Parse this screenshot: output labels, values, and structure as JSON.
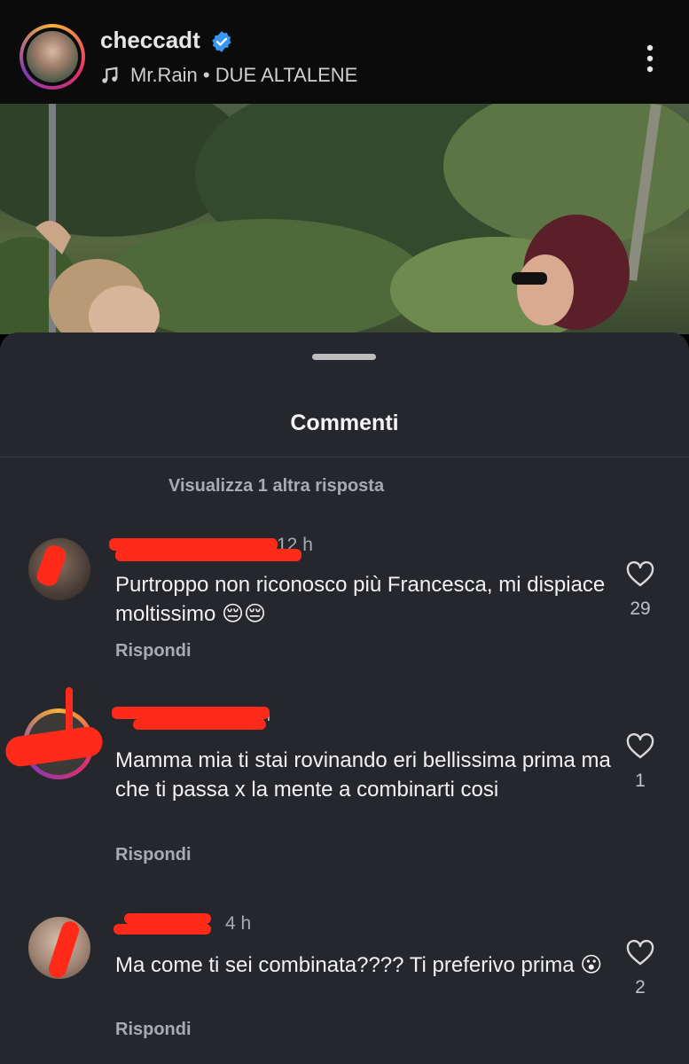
{
  "header": {
    "username": "checcadt",
    "music": "Mr.Rain • DUE ALTALENE"
  },
  "sheet": {
    "title": "Commenti",
    "view_replies": "Visualizza 1 altra risposta"
  },
  "comments": [
    {
      "meta": "12 h",
      "text": "Purtroppo non riconosco più Francesca, mi dispiace moltissimo 😔😔",
      "reply": "Rispondi",
      "likes": "29"
    },
    {
      "meta": "2 h",
      "text": "Mamma mia ti stai rovinando eri bellissima prima ma che ti passa x la mente a combinarti cosi",
      "reply": "Rispondi",
      "likes": "1"
    },
    {
      "meta": "4 h",
      "text": "Ma come ti sei combinata???? Ti preferivo prima 😮",
      "reply": "Rispondi",
      "likes": "2"
    }
  ],
  "colors": {
    "sheet_bg": "#25272c",
    "header_bg": "#0b0b0b",
    "verified": "#3897f0",
    "redaction": "#ff2a1a"
  }
}
